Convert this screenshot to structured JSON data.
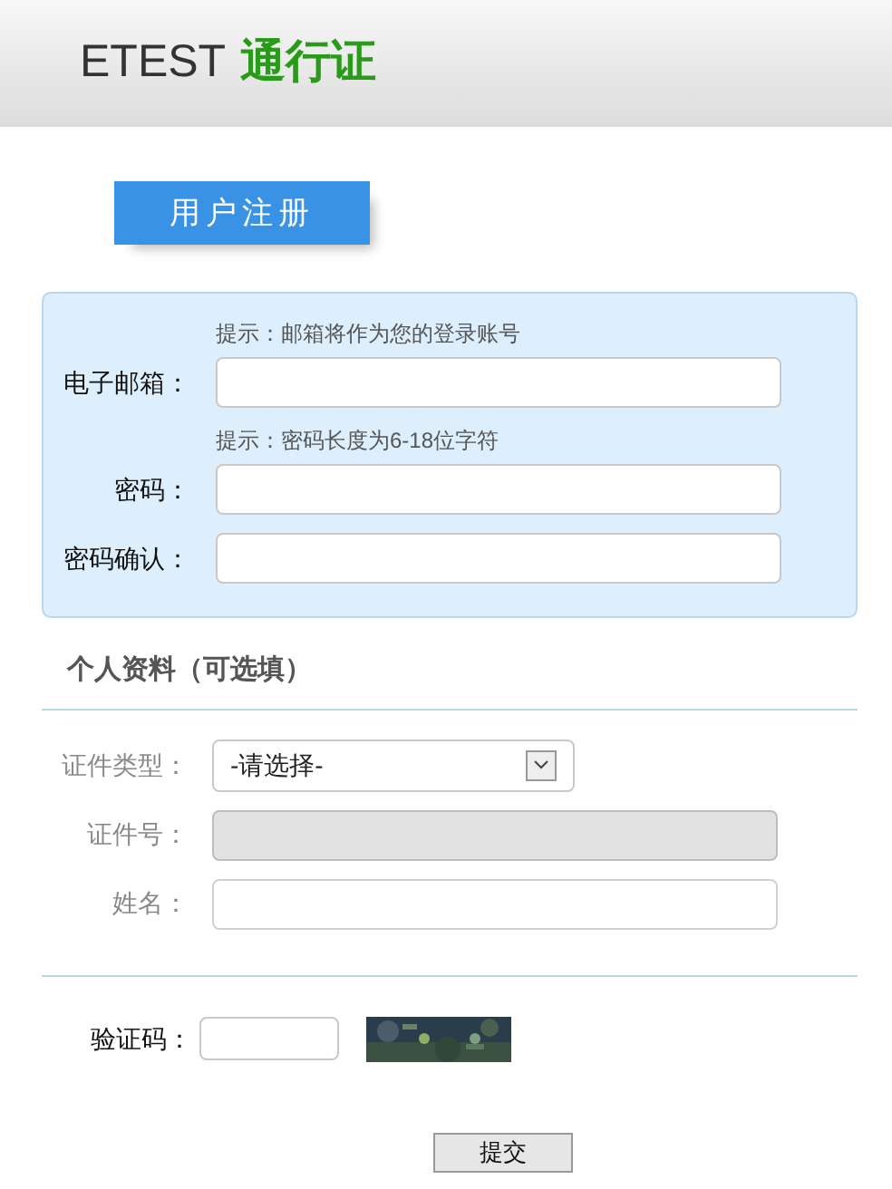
{
  "header": {
    "brand": "ETEST",
    "brand_suffix": "通行证"
  },
  "tab": {
    "label": "用户注册",
    "selected": true
  },
  "account_fields": [
    {
      "label": "电子邮箱：",
      "hint": "提示：邮箱将作为您的登录账号"
    },
    {
      "label": "密码：",
      "hint": "提示：密码长度为6-18位字符"
    },
    {
      "label": "密码确认："
    }
  ],
  "profile": {
    "title": "个人资料（可选填）",
    "fields": [
      {
        "kind": "select",
        "label": "证件类型：",
        "value": "-请选择-"
      },
      {
        "kind": "input",
        "label": "证件号：",
        "disabled": true
      },
      {
        "kind": "input",
        "label": "姓名：",
        "disabled": false
      }
    ]
  },
  "captcha": {
    "label": "验证码："
  },
  "submit": "提交"
}
